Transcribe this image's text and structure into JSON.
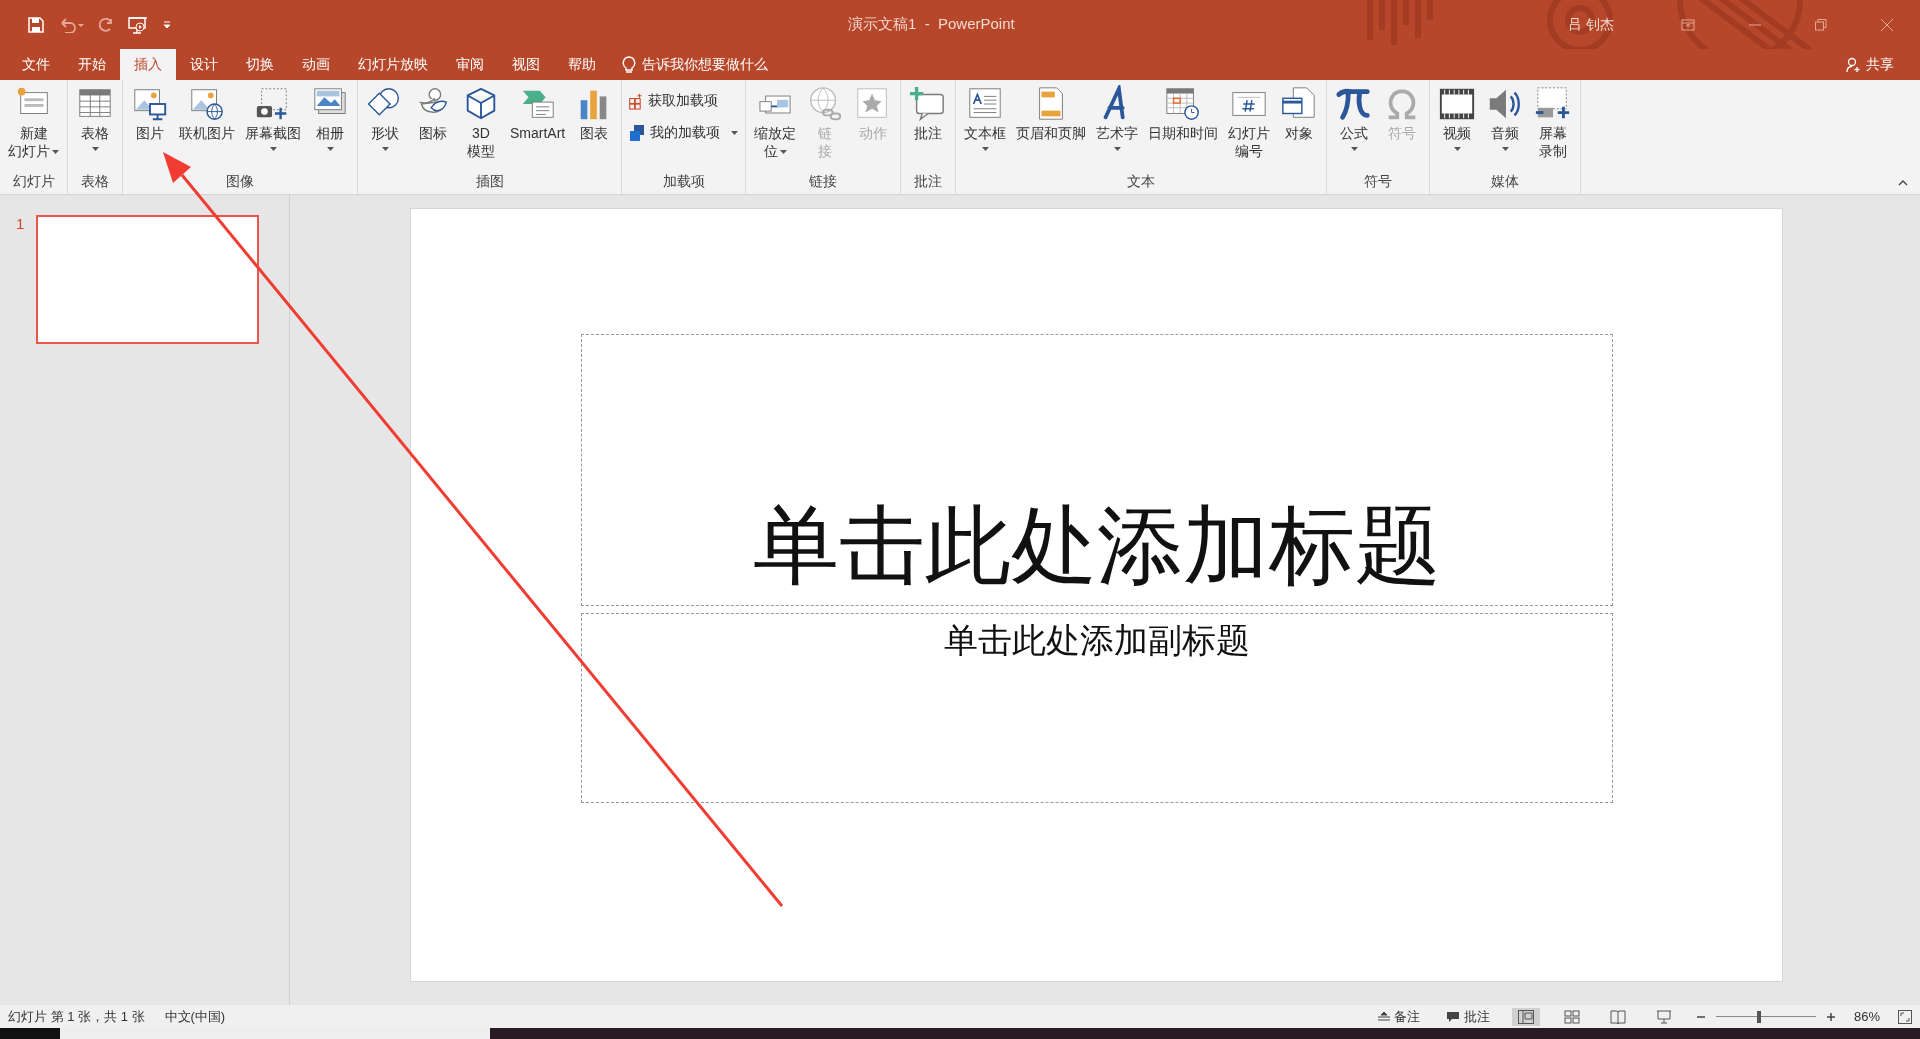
{
  "title_bar": {
    "title": "演示文稿1  -  PowerPoint",
    "user": "吕 钊杰"
  },
  "tabs": [
    {
      "label": "文件",
      "selected": false
    },
    {
      "label": "开始",
      "selected": false
    },
    {
      "label": "插入",
      "selected": true
    },
    {
      "label": "设计",
      "selected": false
    },
    {
      "label": "切换",
      "selected": false
    },
    {
      "label": "动画",
      "selected": false
    },
    {
      "label": "幻灯片放映",
      "selected": false
    },
    {
      "label": "审阅",
      "selected": false
    },
    {
      "label": "视图",
      "selected": false
    },
    {
      "label": "帮助",
      "selected": false
    }
  ],
  "tell_me": "告诉我你想要做什么",
  "share": "共享",
  "ribbon": [
    {
      "label": "幻灯片",
      "buttons": [
        {
          "kind": "large",
          "lines": [
            "新建",
            "幻灯片"
          ],
          "dropdown": true,
          "disabled": false
        }
      ]
    },
    {
      "label": "表格",
      "buttons": [
        {
          "kind": "large",
          "lines": [
            "表格"
          ],
          "dropdown": true,
          "disabled": false
        }
      ]
    },
    {
      "label": "图像",
      "buttons": [
        {
          "kind": "large",
          "lines": [
            "图片"
          ],
          "dropdown": false,
          "disabled": false
        },
        {
          "kind": "large",
          "lines": [
            "联机图片"
          ],
          "dropdown": false,
          "disabled": false
        },
        {
          "kind": "large",
          "lines": [
            "屏幕截图"
          ],
          "dropdown": true,
          "disabled": false
        },
        {
          "kind": "large",
          "lines": [
            "相册"
          ],
          "dropdown": true,
          "disabled": false
        }
      ]
    },
    {
      "label": "插图",
      "buttons": [
        {
          "kind": "large",
          "lines": [
            "形状"
          ],
          "dropdown": true,
          "disabled": false
        },
        {
          "kind": "large",
          "lines": [
            "图标"
          ],
          "dropdown": false,
          "disabled": false
        },
        {
          "kind": "large",
          "lines": [
            "3D",
            "模型"
          ],
          "dropdown": false,
          "disabled": false
        },
        {
          "kind": "large",
          "lines": [
            "SmartArt"
          ],
          "dropdown": false,
          "disabled": false
        },
        {
          "kind": "large",
          "lines": [
            "图表"
          ],
          "dropdown": false,
          "disabled": false
        }
      ]
    },
    {
      "label": "加载项",
      "buttons": [
        {
          "kind": "small",
          "lines": [
            "获取加载项"
          ],
          "dropdown": false,
          "disabled": false
        },
        {
          "kind": "small",
          "lines": [
            "我的加载项"
          ],
          "dropdown": true,
          "disabled": false
        }
      ]
    },
    {
      "label": "链接",
      "buttons": [
        {
          "kind": "large",
          "lines": [
            "缩放定",
            "位"
          ],
          "dropdown": true,
          "disabled": false
        },
        {
          "kind": "large",
          "lines": [
            "链",
            "接"
          ],
          "dropdown": false,
          "disabled": true
        },
        {
          "kind": "large",
          "lines": [
            "动作"
          ],
          "dropdown": false,
          "disabled": true
        }
      ]
    },
    {
      "label": "批注",
      "buttons": [
        {
          "kind": "large",
          "lines": [
            "批注"
          ],
          "dropdown": false,
          "disabled": false
        }
      ]
    },
    {
      "label": "文本",
      "buttons": [
        {
          "kind": "large",
          "lines": [
            "文本框"
          ],
          "dropdown": true,
          "disabled": false
        },
        {
          "kind": "large",
          "lines": [
            "页眉和页脚"
          ],
          "dropdown": false,
          "disabled": false
        },
        {
          "kind": "large",
          "lines": [
            "艺术字"
          ],
          "dropdown": true,
          "disabled": false
        },
        {
          "kind": "large",
          "lines": [
            "日期和时间"
          ],
          "dropdown": false,
          "disabled": false
        },
        {
          "kind": "large",
          "lines": [
            "幻灯片",
            "编号"
          ],
          "dropdown": false,
          "disabled": false
        },
        {
          "kind": "large",
          "lines": [
            "对象"
          ],
          "dropdown": false,
          "disabled": false
        }
      ]
    },
    {
      "label": "符号",
      "buttons": [
        {
          "kind": "large",
          "lines": [
            "公式"
          ],
          "dropdown": true,
          "disabled": false
        },
        {
          "kind": "large",
          "lines": [
            "符号"
          ],
          "dropdown": false,
          "disabled": true
        }
      ]
    },
    {
      "label": "媒体",
      "buttons": [
        {
          "kind": "large",
          "lines": [
            "视频"
          ],
          "dropdown": true,
          "disabled": false
        },
        {
          "kind": "large",
          "lines": [
            "音频"
          ],
          "dropdown": true,
          "disabled": false
        },
        {
          "kind": "large",
          "lines": [
            "屏幕",
            "录制"
          ],
          "dropdown": false,
          "disabled": false
        }
      ]
    }
  ],
  "thumbnails": [
    {
      "number": "1",
      "selected": true
    }
  ],
  "slide": {
    "title_placeholder": "单击此处添加标题",
    "subtitle_placeholder": "单击此处添加副标题"
  },
  "status_bar": {
    "slide_info": "幻灯片 第 1 张，共 1 张",
    "language": "中文(中国)",
    "notes": "备注",
    "comments": "批注",
    "views": [
      {
        "selected": true
      },
      {
        "selected": false
      },
      {
        "selected": false
      },
      {
        "selected": false
      }
    ],
    "zoom": {
      "level": 0.43,
      "reading": "86%"
    }
  }
}
